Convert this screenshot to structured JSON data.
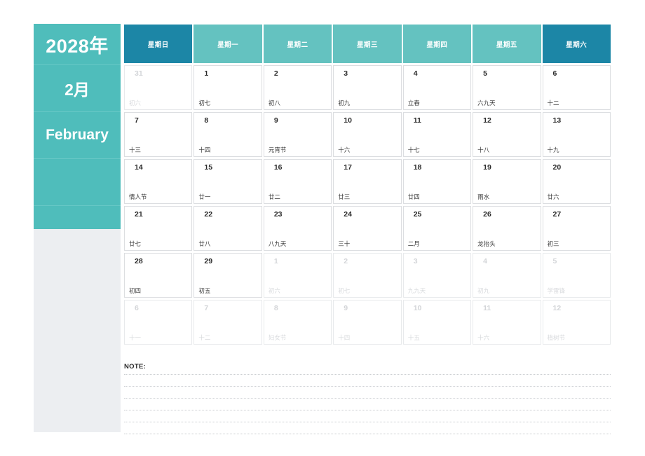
{
  "sidebar": {
    "year": "2028年",
    "month_cn": "2月",
    "month_en": "February",
    "blank_1": "",
    "blank_2": ""
  },
  "colors": {
    "teal": "#4fbdbb",
    "teal_header": "#64c2c0",
    "teal_weekend": "#1c86a6",
    "panel_gray": "#eceef1",
    "cell_border": "#dcdee1",
    "text_dark": "#2b2b2b",
    "text_muted": "#d3d5d8"
  },
  "weekdays": [
    {
      "label": "星期日",
      "weekend": true
    },
    {
      "label": "星期一",
      "weekend": false
    },
    {
      "label": "星期二",
      "weekend": false
    },
    {
      "label": "星期三",
      "weekend": false
    },
    {
      "label": "星期四",
      "weekend": false
    },
    {
      "label": "星期五",
      "weekend": false
    },
    {
      "label": "星期六",
      "weekend": true
    }
  ],
  "weeks": [
    [
      {
        "day": "31",
        "lunar": "初六",
        "out": true
      },
      {
        "day": "1",
        "lunar": "初七",
        "out": false
      },
      {
        "day": "2",
        "lunar": "初八",
        "out": false
      },
      {
        "day": "3",
        "lunar": "初九",
        "out": false
      },
      {
        "day": "4",
        "lunar": "立春",
        "out": false
      },
      {
        "day": "5",
        "lunar": "六九天",
        "out": false
      },
      {
        "day": "6",
        "lunar": "十二",
        "out": false
      }
    ],
    [
      {
        "day": "7",
        "lunar": "十三",
        "out": false
      },
      {
        "day": "8",
        "lunar": "十四",
        "out": false
      },
      {
        "day": "9",
        "lunar": "元宵节",
        "out": false
      },
      {
        "day": "10",
        "lunar": "十六",
        "out": false
      },
      {
        "day": "11",
        "lunar": "十七",
        "out": false
      },
      {
        "day": "12",
        "lunar": "十八",
        "out": false
      },
      {
        "day": "13",
        "lunar": "十九",
        "out": false
      }
    ],
    [
      {
        "day": "14",
        "lunar": "情人节",
        "out": false
      },
      {
        "day": "15",
        "lunar": "廿一",
        "out": false
      },
      {
        "day": "16",
        "lunar": "廿二",
        "out": false
      },
      {
        "day": "17",
        "lunar": "廿三",
        "out": false
      },
      {
        "day": "18",
        "lunar": "廿四",
        "out": false
      },
      {
        "day": "19",
        "lunar": "雨水",
        "out": false
      },
      {
        "day": "20",
        "lunar": "廿六",
        "out": false
      }
    ],
    [
      {
        "day": "21",
        "lunar": "廿七",
        "out": false
      },
      {
        "day": "22",
        "lunar": "廿八",
        "out": false
      },
      {
        "day": "23",
        "lunar": "八九天",
        "out": false
      },
      {
        "day": "24",
        "lunar": "三十",
        "out": false
      },
      {
        "day": "25",
        "lunar": "二月",
        "out": false
      },
      {
        "day": "26",
        "lunar": "龙抬头",
        "out": false
      },
      {
        "day": "27",
        "lunar": "初三",
        "out": false
      }
    ],
    [
      {
        "day": "28",
        "lunar": "初四",
        "out": false
      },
      {
        "day": "29",
        "lunar": "初五",
        "out": false
      },
      {
        "day": "1",
        "lunar": "初六",
        "out": true
      },
      {
        "day": "2",
        "lunar": "初七",
        "out": true
      },
      {
        "day": "3",
        "lunar": "九九天",
        "out": true
      },
      {
        "day": "4",
        "lunar": "初九",
        "out": true
      },
      {
        "day": "5",
        "lunar": "学雷锋",
        "out": true
      }
    ],
    [
      {
        "day": "6",
        "lunar": "十一",
        "out": true
      },
      {
        "day": "7",
        "lunar": "十二",
        "out": true
      },
      {
        "day": "8",
        "lunar": "妇女节",
        "out": true
      },
      {
        "day": "9",
        "lunar": "十四",
        "out": true
      },
      {
        "day": "10",
        "lunar": "十五",
        "out": true
      },
      {
        "day": "11",
        "lunar": "十六",
        "out": true
      },
      {
        "day": "12",
        "lunar": "植树节",
        "out": true
      }
    ]
  ],
  "note": {
    "label": "NOTE:",
    "line_count": 6
  }
}
